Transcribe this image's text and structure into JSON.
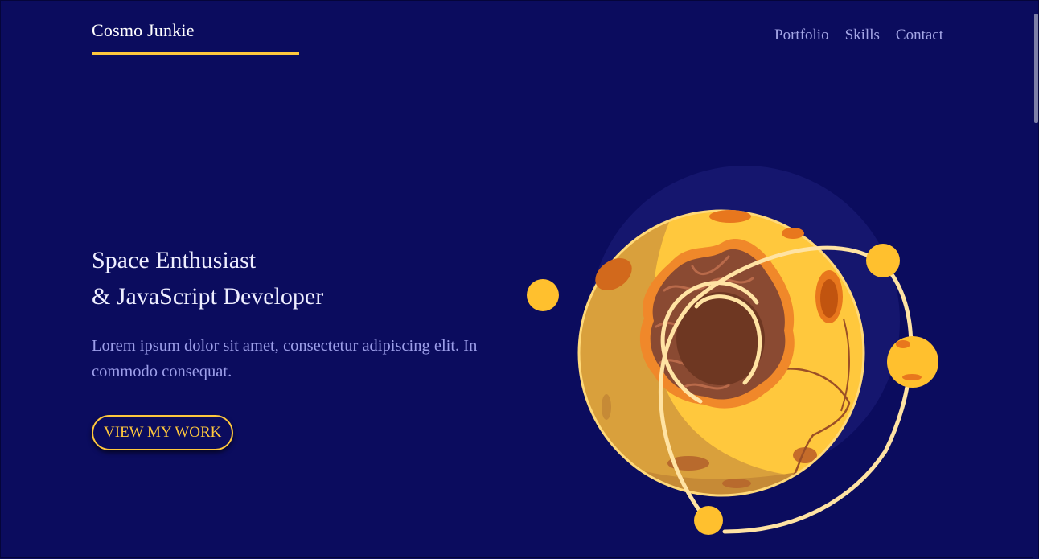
{
  "header": {
    "logo": "Cosmo Junkie",
    "nav": [
      "Portfolio",
      "Skills",
      "Contact"
    ]
  },
  "hero": {
    "title_line1": "Space Enthusiast",
    "title_line2": "& JavaScript Developer",
    "description": "Lorem ipsum dolor sit amet, consectetur adipiscing elit. In commodo consequat.",
    "cta_label": "VIEW MY WORK"
  },
  "illustration": {
    "name": "planet-with-orbiting-moons",
    "colors": {
      "background": "#0b0c5e",
      "accent": "#ffc83d",
      "planet": "#ffc83d",
      "crater": "#8a4a32",
      "nav_text": "#a4a6e6",
      "body_text": "#9d9fea"
    }
  }
}
